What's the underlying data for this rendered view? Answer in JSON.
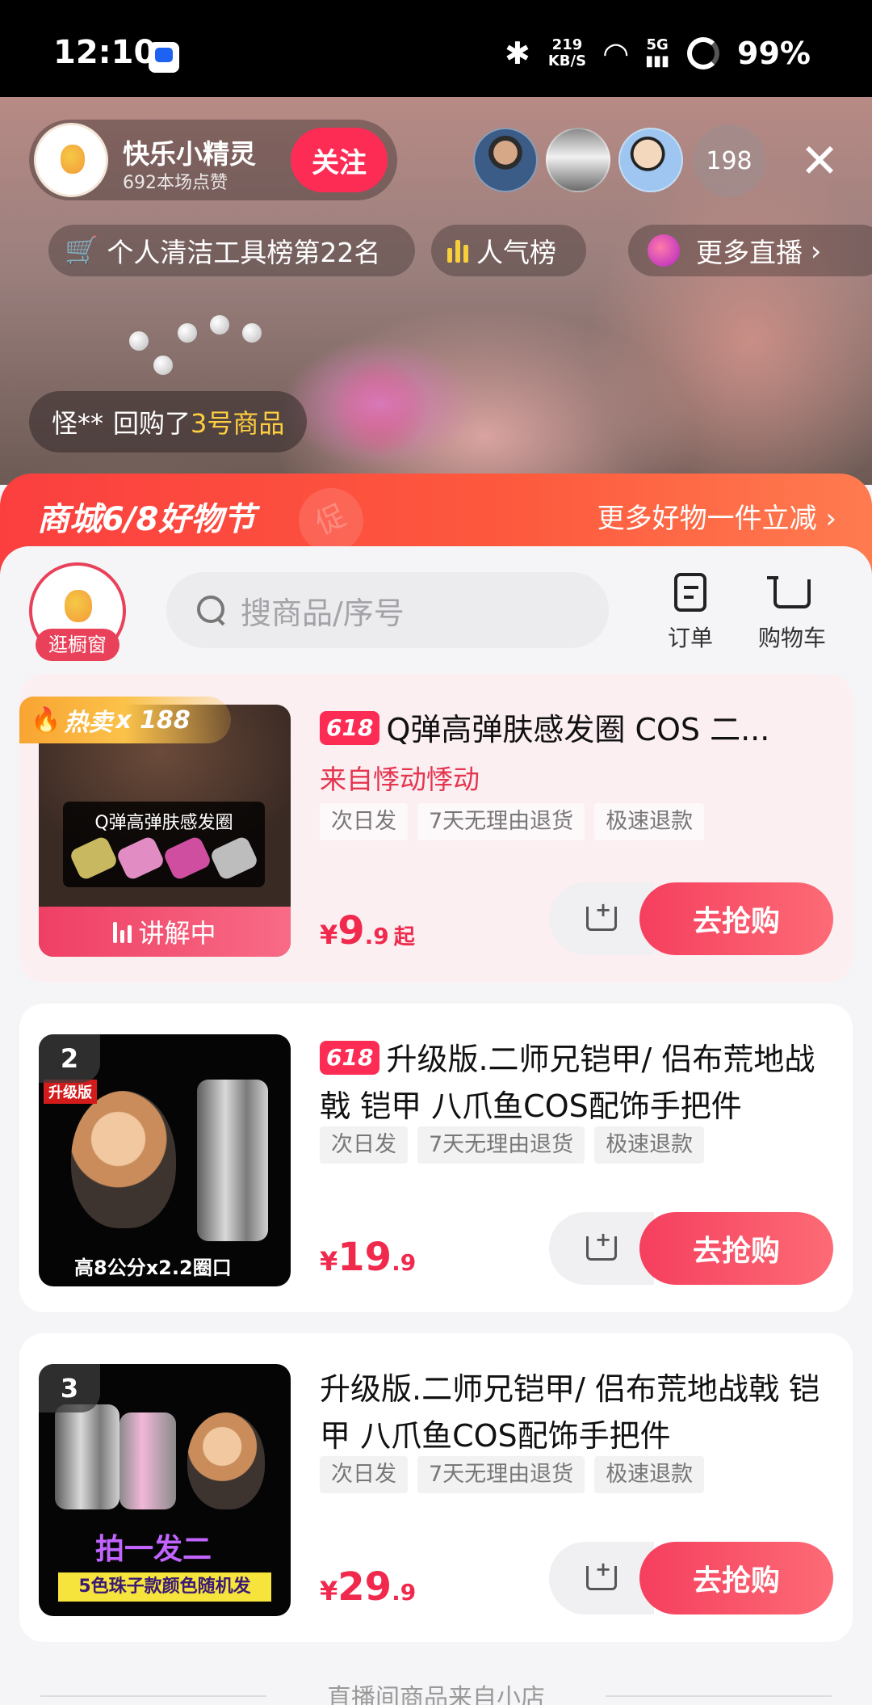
{
  "status_bar": {
    "time": "12:10",
    "net_speed_value": "219",
    "net_speed_unit": "KB/S",
    "network": "5G",
    "battery": "99%"
  },
  "host": {
    "name": "快乐小精灵",
    "likes": "692本场点赞",
    "follow_label": "关注"
  },
  "viewers": {
    "count": "198"
  },
  "live_pills": {
    "rank": "个人清洁工具榜第22名",
    "popularity": "人气榜",
    "more_live": "更多直播"
  },
  "purchase_toast": {
    "user": "怪**",
    "action": "回购了",
    "item": "3号商品"
  },
  "promo": {
    "title": "商城6/8好物节",
    "more": "更多好物一件立减"
  },
  "shop": {
    "window_label": "逛橱窗",
    "search_placeholder": "搜商品/序号",
    "orders_label": "订单",
    "cart_label": "购物车"
  },
  "products": [
    {
      "badge": "618",
      "title": "Q弹高弹肤感发圈  COS 二...",
      "source": "来自悸动悸动",
      "tags": [
        "次日发",
        "7天无理由退货",
        "极速退款"
      ],
      "price_symbol": "¥",
      "price_int": "9",
      "price_dec": ".9",
      "price_suffix": "起",
      "buy_label": "去抢购",
      "hot_label": "热卖",
      "hot_count": "x 188",
      "live_label": "讲解中",
      "thumb_caption": "Q弹高弹肤感发圈"
    },
    {
      "rank": "2",
      "badge": "618",
      "title": "升级版.二师兄铠甲/ 侣布荒地战戟 铠甲 八爪鱼COS配饰手把件",
      "tags": [
        "次日发",
        "7天无理由退货",
        "极速退款"
      ],
      "price_symbol": "¥",
      "price_int": "19",
      "price_dec": ".9",
      "buy_label": "去抢购",
      "thumb_corner": "升级版",
      "thumb_caption": "高8公分x2.2圈口"
    },
    {
      "rank": "3",
      "title": "升级版.二师兄铠甲/ 侣布荒地战戟 铠甲 八爪鱼COS配饰手把件",
      "tags": [
        "次日发",
        "7天无理由退货",
        "极速退款"
      ],
      "price_symbol": "¥",
      "price_int": "29",
      "price_dec": ".9",
      "buy_label": "去抢购",
      "thumb_purple": "拍一发二",
      "thumb_caption": "5色珠子款颜色随机发"
    }
  ],
  "footer_note": "直播间商品来自小店"
}
